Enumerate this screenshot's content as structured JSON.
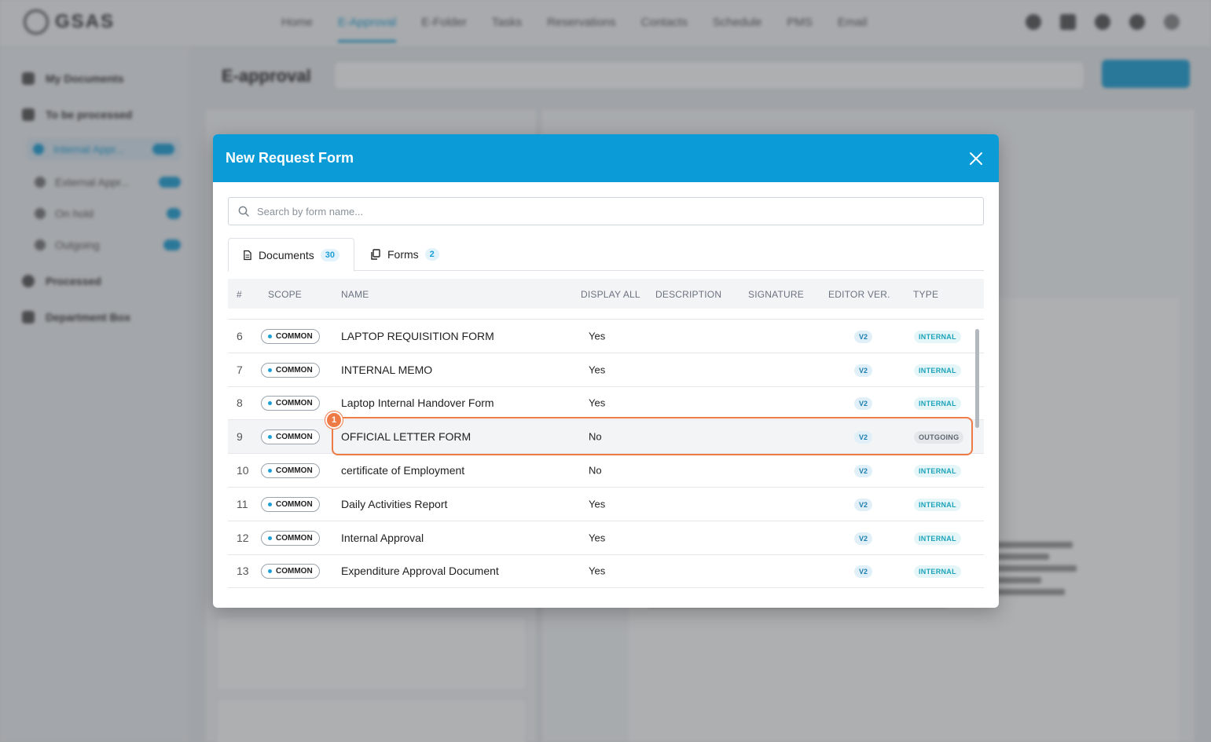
{
  "modal": {
    "title": "New Request Form",
    "search_placeholder": "Search by form name...",
    "tabs": [
      {
        "label": "Documents",
        "count": "30"
      },
      {
        "label": "Forms",
        "count": "2"
      }
    ],
    "columns": [
      "#",
      "SCOPE",
      "NAME",
      "DISPLAY ALL",
      "DESCRIPTION",
      "SIGNATURE",
      "EDITOR VER.",
      "TYPE"
    ],
    "rows": [
      {
        "num": "6",
        "scope": "COMMON",
        "name": "LAPTOP REQUISITION FORM",
        "display_all": "Yes",
        "editor_ver": "V2",
        "type": "INTERNAL"
      },
      {
        "num": "7",
        "scope": "COMMON",
        "name": "INTERNAL MEMO",
        "display_all": "Yes",
        "editor_ver": "V2",
        "type": "INTERNAL"
      },
      {
        "num": "8",
        "scope": "COMMON",
        "name": "Laptop Internal Handover Form",
        "display_all": "Yes",
        "editor_ver": "V2",
        "type": "INTERNAL"
      },
      {
        "num": "9",
        "scope": "COMMON",
        "name": "OFFICIAL LETTER FORM",
        "display_all": "No",
        "editor_ver": "V2",
        "type": "OUTGOING"
      },
      {
        "num": "10",
        "scope": "COMMON",
        "name": "certificate of Employment",
        "display_all": "No",
        "editor_ver": "V2",
        "type": "INTERNAL"
      },
      {
        "num": "11",
        "scope": "COMMON",
        "name": "Daily Activities Report",
        "display_all": "Yes",
        "editor_ver": "V2",
        "type": "INTERNAL"
      },
      {
        "num": "12",
        "scope": "COMMON",
        "name": "Internal Approval",
        "display_all": "Yes",
        "editor_ver": "V2",
        "type": "INTERNAL"
      },
      {
        "num": "13",
        "scope": "COMMON",
        "name": "Expenditure Approval Document",
        "display_all": "Yes",
        "editor_ver": "V2",
        "type": "INTERNAL"
      }
    ],
    "step_marker": "1"
  },
  "background": {
    "logo": "GSAS",
    "nav": [
      "Home",
      "E-Approval",
      "E-Folder",
      "Tasks",
      "Reservations",
      "Contacts",
      "Schedule",
      "PMS",
      "Email"
    ],
    "page_title": "E-approval",
    "sidebar": [
      "My Documents",
      "To be processed",
      "Internal Appr...",
      "External Appr...",
      "On hold",
      "Outgoing",
      "Processed",
      "Department Box"
    ]
  },
  "colors": {
    "header": "#0b9bd6",
    "highlight": "#ee7a45",
    "accent": "#1d9fd6"
  }
}
